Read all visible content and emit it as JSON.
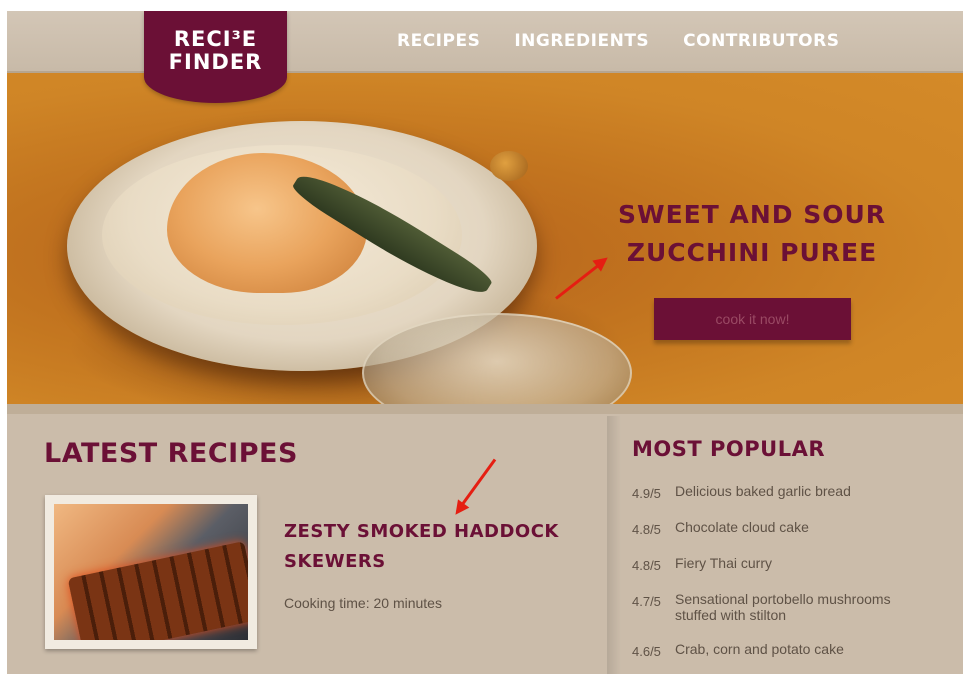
{
  "logo": {
    "line1": "RECI³E",
    "line2": "FINDER"
  },
  "nav": {
    "items": [
      {
        "label": "RECIPES"
      },
      {
        "label": "INGREDIENTS"
      },
      {
        "label": "CONTRIBUTORS"
      }
    ]
  },
  "hero": {
    "title": "SWEET AND SOUR ZUCCHINI PUREE",
    "button_label": "cook it now!"
  },
  "latest": {
    "heading": "LATEST RECIPES",
    "recipe": {
      "title": "ZESTY SMOKED HADDOCK SKEWERS",
      "cooking_time": "Cooking time: 20 minutes"
    }
  },
  "popular": {
    "heading": "MOST POPULAR",
    "items": [
      {
        "rating": "4.9/5",
        "name": "Delicious baked garlic bread"
      },
      {
        "rating": "4.8/5",
        "name": "Chocolate cloud cake"
      },
      {
        "rating": "4.8/5",
        "name": "Fiery Thai curry"
      },
      {
        "rating": "4.7/5",
        "name": "Sensational portobello mushrooms stuffed with stilton"
      },
      {
        "rating": "4.6/5",
        "name": "Crab, corn and potato cake"
      }
    ]
  },
  "colors": {
    "brand": "#6b1036",
    "background": "#cdbfae",
    "hero": "#c2741f",
    "annotation_arrow": "#e51e12"
  }
}
